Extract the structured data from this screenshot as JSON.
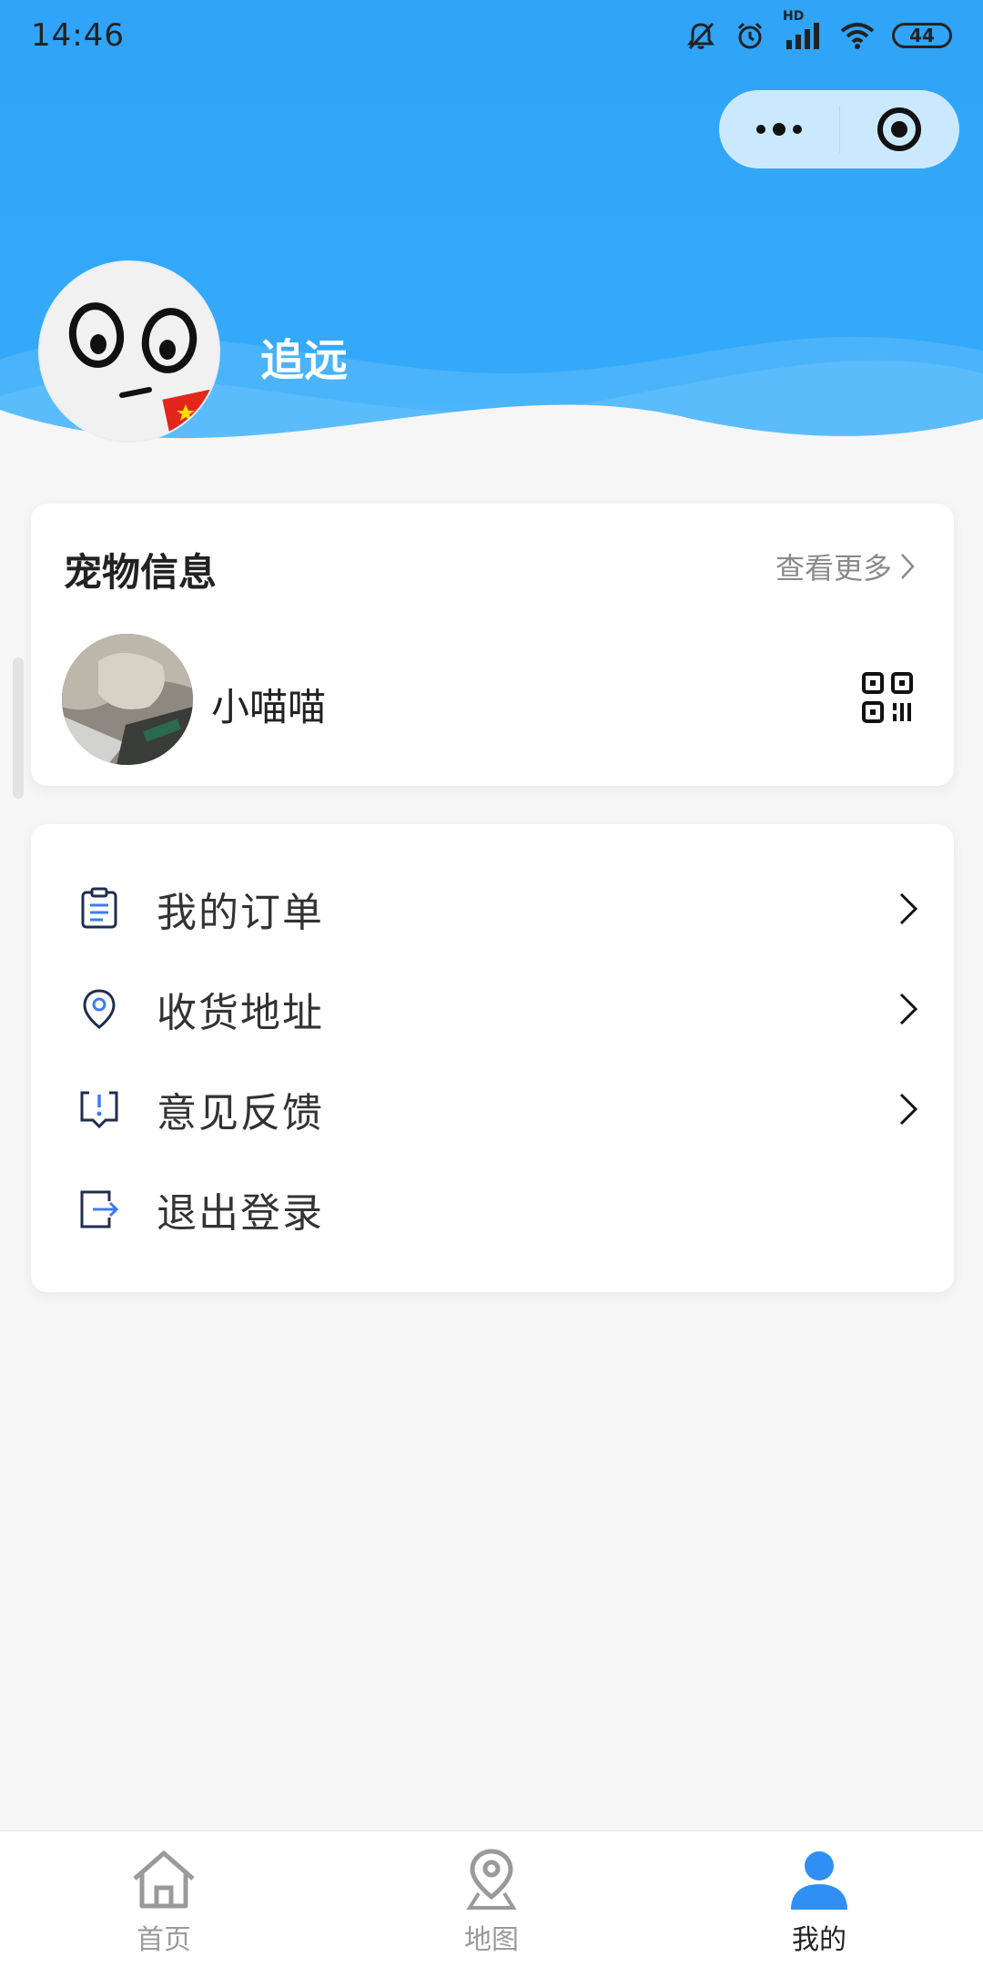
{
  "status_bar": {
    "time": "14:46",
    "battery": "44",
    "network_badge": "HD"
  },
  "profile": {
    "username": "追远"
  },
  "pet_card": {
    "title": "宠物信息",
    "more_label": "查看更多",
    "pet_name": "小喵喵"
  },
  "menu": {
    "items": [
      {
        "label": "我的订单",
        "icon": "clipboard-icon",
        "has_arrow": true
      },
      {
        "label": "收货地址",
        "icon": "location-pin-icon",
        "has_arrow": true
      },
      {
        "label": "意见反馈",
        "icon": "feedback-icon",
        "has_arrow": true
      },
      {
        "label": "退出登录",
        "icon": "logout-icon",
        "has_arrow": false
      }
    ]
  },
  "tabbar": {
    "tabs": [
      {
        "label": "首页",
        "icon": "home-icon",
        "active": false
      },
      {
        "label": "地图",
        "icon": "map-pin-icon",
        "active": false
      },
      {
        "label": "我的",
        "icon": "user-icon",
        "active": true
      }
    ]
  },
  "colors": {
    "primary": "#2fa4f8",
    "accent": "#3b7cf0",
    "background": "#f6f6f6"
  }
}
